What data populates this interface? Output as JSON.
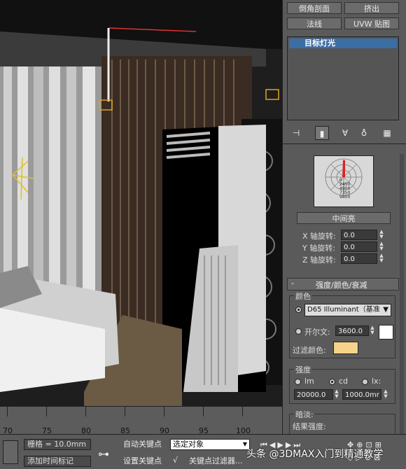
{
  "top_buttons": {
    "bevel_profile": "倒角剖面",
    "extrude": "挤出",
    "normal": "法线",
    "uvw_map": "UVW 贴图"
  },
  "modifier_stack": {
    "selected_item": "目标灯光"
  },
  "photometric": {
    "web_values": [
      "0",
      "2450",
      "4900",
      "7350",
      "9800"
    ],
    "web_name": "中间亮",
    "x_rot_label": "X 轴旋转:",
    "x_rot_value": "0.0",
    "y_rot_label": "Y 轴旋转:",
    "y_rot_value": "0.0",
    "z_rot_label": "Z 轴旋转:",
    "z_rot_value": "0.0"
  },
  "intensity_rollout": {
    "title": "强度/颜色/衰减",
    "color_group": "颜色",
    "preset_value": "D65 Illuminant（基准",
    "kelvin_label": "开尔文:",
    "kelvin_value": "3600.0",
    "filter_label": "过滤颜色:",
    "filter_color": "#f5d38a",
    "kelvin_color": "#ffffff",
    "intensity_group": "强度",
    "unit_lm": "lm",
    "unit_cd": "cd",
    "unit_lx": "lx:",
    "intensity_value": "20000.0",
    "distance_value": "1000.0mr",
    "dimming_group": "暗淡:",
    "result_label": "结果强度:"
  },
  "timeline": {
    "ticks": [
      "70",
      "75",
      "80",
      "85",
      "90",
      "95",
      "100"
    ]
  },
  "bottom": {
    "grid_label": "栅格 = 10.0mm",
    "add_time_tag": "添加时间标记",
    "auto_key": "自动关键点",
    "set_key": "设置关键点",
    "selected_object": "选定对象",
    "key_filters": "关键点过滤器...",
    "watermark": "头条 @3DMAX入门到精通教学"
  }
}
